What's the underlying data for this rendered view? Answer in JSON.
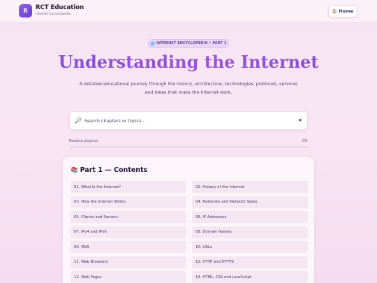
{
  "brand": {
    "logo_letter": "R",
    "title": "RCT Education",
    "subtitle": "Internet Encyclopedia"
  },
  "nav": {
    "home_icon": "house-icon",
    "home_label": "Home"
  },
  "hero": {
    "badge": "INTERNET ENCYCLOPEDIA • PART 1",
    "badge_icon": "globe-icon",
    "title": "Understanding the Internet",
    "description": "A detailed educational journey through the history, architecture, technologies, protocols, services and ideas that make the Internet work."
  },
  "search": {
    "placeholder": "Search chapters or topics...",
    "value": "",
    "icon": "magnifier-icon",
    "clear_label": "×"
  },
  "progress": {
    "label": "Reading progress",
    "percent_text": "0%",
    "percent": 0
  },
  "contents": {
    "icon": "books-icon",
    "title": "Part 1 — Contents",
    "items": [
      "01. What Is the Internet?",
      "02. History of the Internet",
      "03. How the Internet Works",
      "04. Networks and Network Types",
      "05. Clients and Servers",
      "06. IP Addresses",
      "07. IPv4 and IPv6",
      "08. Domain Names",
      "09. DNS",
      "10. URLs",
      "11. Web Browsers",
      "12. HTTP and HTTPS",
      "13. Web Pages",
      "14. HTML, CSS and JavaScript"
    ]
  },
  "colors": {
    "accent": "#7c4ddc",
    "background": "#f9e6f4",
    "card": "#fcf5fa"
  }
}
